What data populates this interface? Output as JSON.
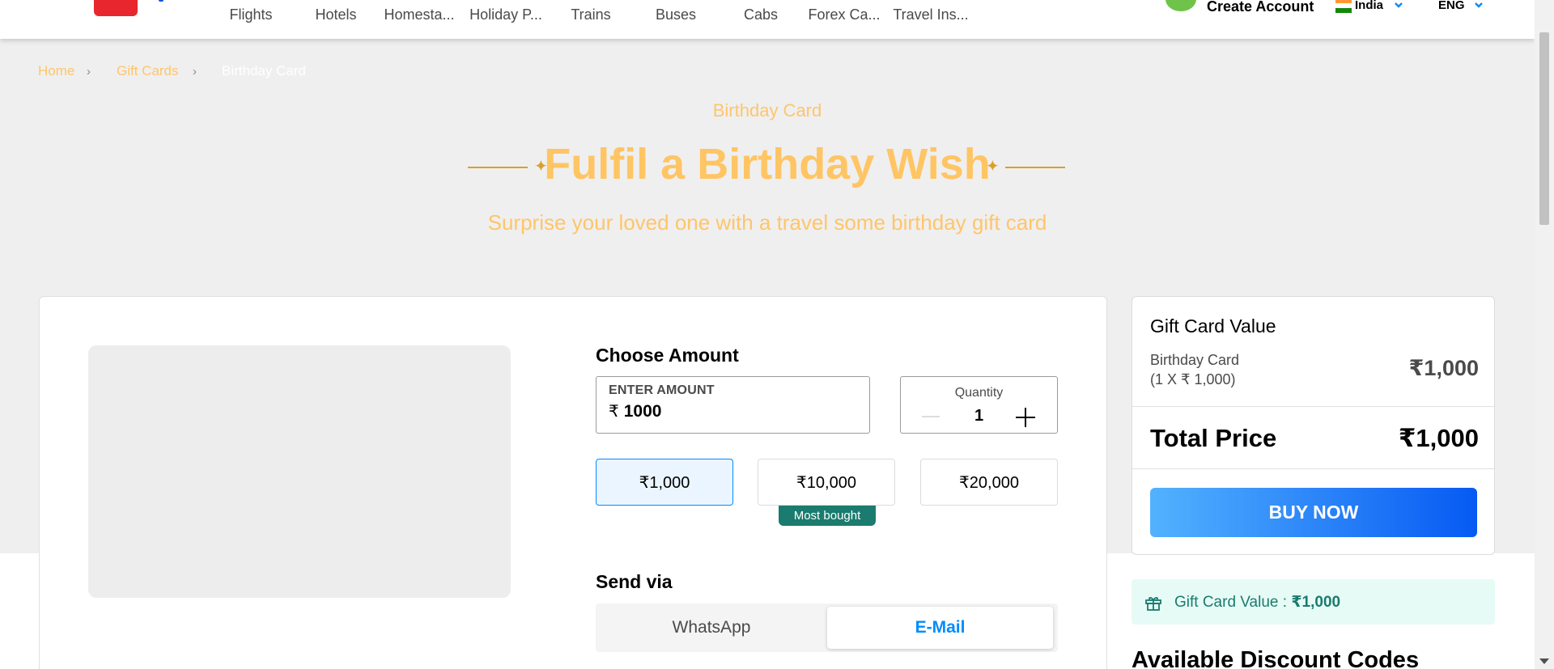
{
  "nav": {
    "items": [
      "Flights",
      "Hotels",
      "Homesta...",
      "Holiday P...",
      "Trains",
      "Buses",
      "Cabs",
      "Forex Ca...",
      "Travel Ins..."
    ],
    "create_account": "Create Account",
    "country": "India",
    "language": "ENG"
  },
  "breadcrumb": {
    "home": "Home",
    "gift_cards": "Gift Cards",
    "current": "Birthday Card",
    "separator": "›"
  },
  "hero": {
    "category": "Birthday Card",
    "title": "Fulfil a Birthday Wish",
    "tagline": "Surprise your loved one with a travel some birthday gift card",
    "star": "✦"
  },
  "amount": {
    "heading": "Choose Amount",
    "input_label": "ENTER AMOUNT",
    "currency_symbol": "₹",
    "input_value": "1000",
    "quantity_label": "Quantity",
    "quantity_value": "1",
    "presets": [
      "₹1,000",
      "₹10,000",
      "₹20,000"
    ],
    "selected_preset": "₹1,000",
    "most_bought_label": "Most bought"
  },
  "send_via": {
    "heading": "Send via",
    "tabs": [
      "WhatsApp",
      "E-Mail"
    ],
    "active_tab": "E-Mail"
  },
  "summary": {
    "title": "Gift Card Value",
    "item_name": "Birthday Card",
    "item_detail": "(1 X ₹ 1,000)",
    "item_value": "₹1,000",
    "total_label": "Total Price",
    "total_value": "₹1,000",
    "buy_label": "BUY NOW"
  },
  "value_strip": {
    "label": "Gift Card Value : ",
    "value": "₹1,000"
  },
  "discount_heading": "Available Discount Codes",
  "colors": {
    "accent": "#008cff",
    "hero_gold": "#ffc56b",
    "teal": "#1a7b6e",
    "brand_red": "#e8262d"
  }
}
